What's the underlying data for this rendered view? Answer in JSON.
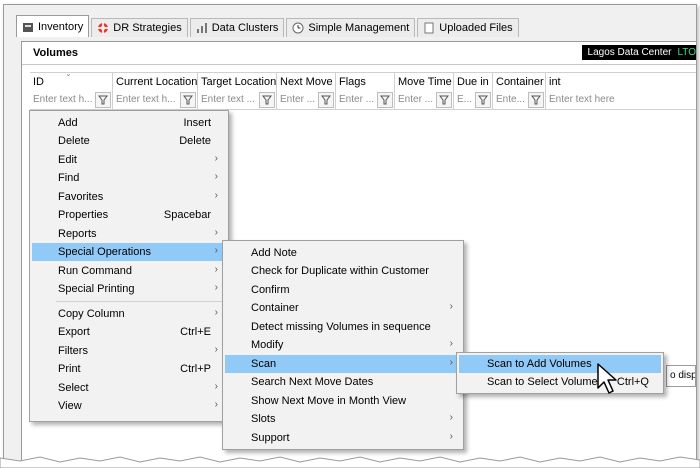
{
  "tabs": [
    {
      "label": "Inventory",
      "icon": "inventory-icon",
      "active": true
    },
    {
      "label": "DR Strategies",
      "icon": "lifebuoy-icon"
    },
    {
      "label": "Data Clusters",
      "icon": "bar-chart-icon"
    },
    {
      "label": "Simple Management",
      "icon": "clock-icon"
    },
    {
      "label": "Uploaded Files",
      "icon": "document-icon"
    }
  ],
  "panel": {
    "title": "Volumes",
    "data_center": "Lagos Data Center",
    "lto": "LTO"
  },
  "columns": [
    {
      "label": "ID",
      "placeholder": "Enter text h..."
    },
    {
      "label": "Current Location",
      "placeholder": "Enter text h..."
    },
    {
      "label": "Target Location",
      "placeholder": "Enter text ..."
    },
    {
      "label": "Next Move",
      "placeholder": "Enter ..."
    },
    {
      "label": "Flags",
      "placeholder": "Enter ..."
    },
    {
      "label": "Move Time",
      "placeholder": "Enter ..."
    },
    {
      "label": "Due in",
      "placeholder": "E..."
    },
    {
      "label": "Container",
      "placeholder": "Ente..."
    },
    {
      "label": "int",
      "placeholder": "Enter text here"
    }
  ],
  "context_menu": [
    {
      "label": "Add",
      "shortcut": "Insert"
    },
    {
      "label": "Delete",
      "shortcut": "Delete"
    },
    {
      "label": "Edit",
      "submenu": true
    },
    {
      "label": "Find",
      "submenu": true
    },
    {
      "label": "Favorites",
      "submenu": true
    },
    {
      "label": "Properties",
      "shortcut": "Spacebar"
    },
    {
      "label": "Reports",
      "submenu": true
    },
    {
      "label": "Special Operations",
      "submenu": true,
      "selected": true
    },
    {
      "label": "Run Command",
      "submenu": true
    },
    {
      "label": "Special Printing",
      "submenu": true
    },
    {
      "label": "Copy Column",
      "submenu": true
    },
    {
      "label": "Export",
      "shortcut": "Ctrl+E"
    },
    {
      "label": "Filters",
      "submenu": true
    },
    {
      "label": "Print",
      "shortcut": "Ctrl+P"
    },
    {
      "label": "Select",
      "submenu": true
    },
    {
      "label": "View",
      "submenu": true
    }
  ],
  "special_operations_menu": [
    {
      "label": "Add Note"
    },
    {
      "label": "Check for Duplicate within Customer"
    },
    {
      "label": "Confirm"
    },
    {
      "label": "Container",
      "submenu": true
    },
    {
      "label": "Detect missing Volumes in sequence"
    },
    {
      "label": "Modify",
      "submenu": true
    },
    {
      "label": "Scan",
      "submenu": true,
      "selected": true
    },
    {
      "label": "Search Next Move Dates"
    },
    {
      "label": "Show Next Move in Month View"
    },
    {
      "label": "Slots",
      "submenu": true
    },
    {
      "label": "Support",
      "submenu": true
    }
  ],
  "scan_menu": [
    {
      "label": "Scan to Add Volumes",
      "selected": true
    },
    {
      "label": "Scan to Select Volumes",
      "shortcut": "Ctrl+Q"
    }
  ],
  "partial_text": "o displa",
  "colors": {
    "highlight": "#91c9f7",
    "menu_bg": "#f2f2f2",
    "lto": "#3ddc84"
  }
}
